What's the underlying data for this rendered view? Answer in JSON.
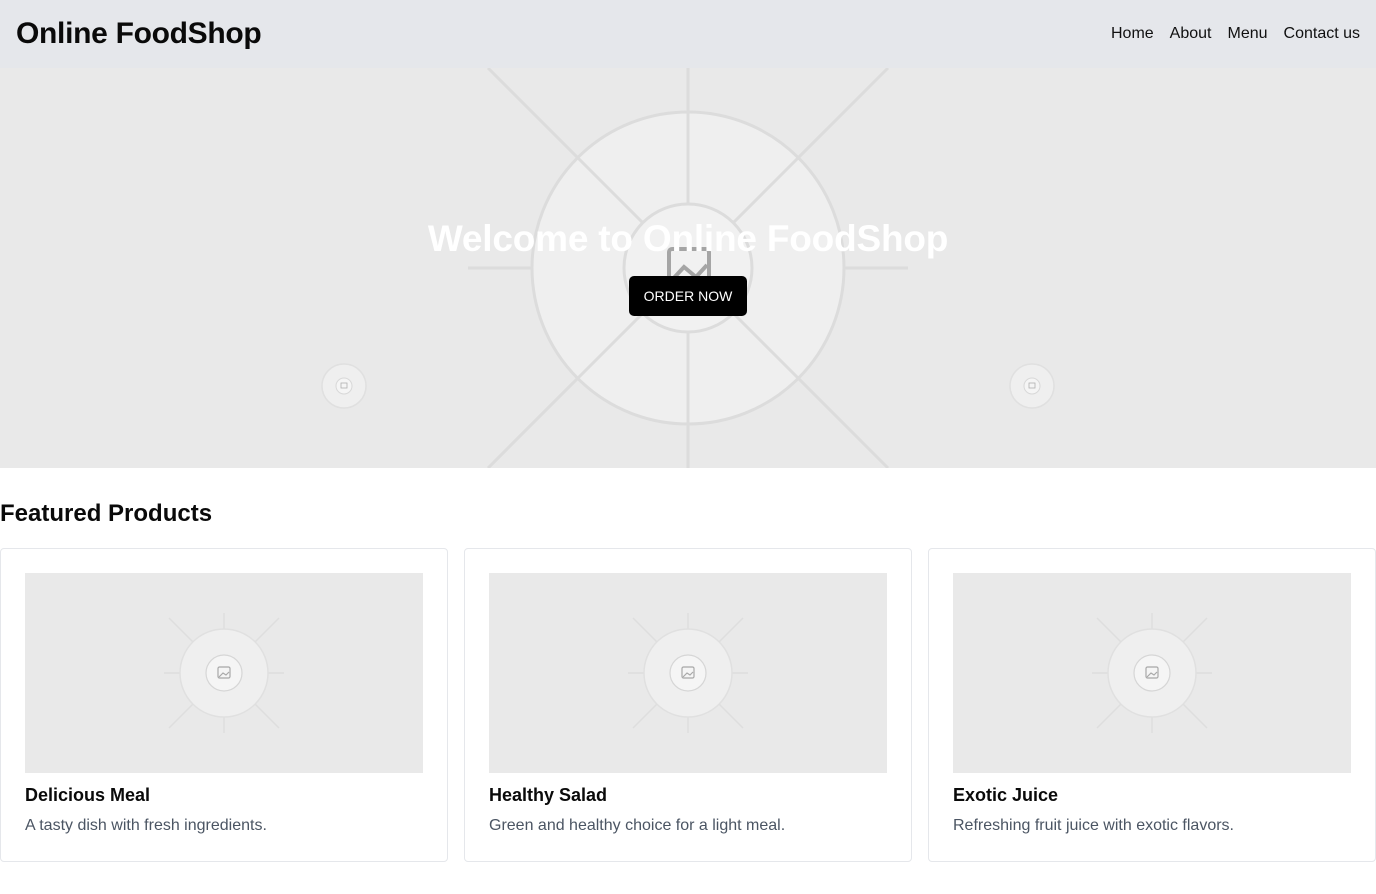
{
  "header": {
    "brand": "Online FoodShop",
    "nav": [
      "Home",
      "About",
      "Menu",
      "Contact us"
    ]
  },
  "hero": {
    "title": "Welcome to Online FoodShop",
    "cta_label": "ORDER NOW"
  },
  "featured": {
    "title": "Featured Products",
    "products": [
      {
        "name": "Delicious Meal",
        "description": "A tasty dish with fresh ingredients."
      },
      {
        "name": "Healthy Salad",
        "description": "Green and healthy choice for a light meal."
      },
      {
        "name": "Exotic Juice",
        "description": "Refreshing fruit juice with exotic flavors."
      }
    ]
  },
  "colors": {
    "header_bg": "#e5e7eb",
    "placeholder_bg": "#e9e9e9",
    "cta_bg": "#000000"
  }
}
